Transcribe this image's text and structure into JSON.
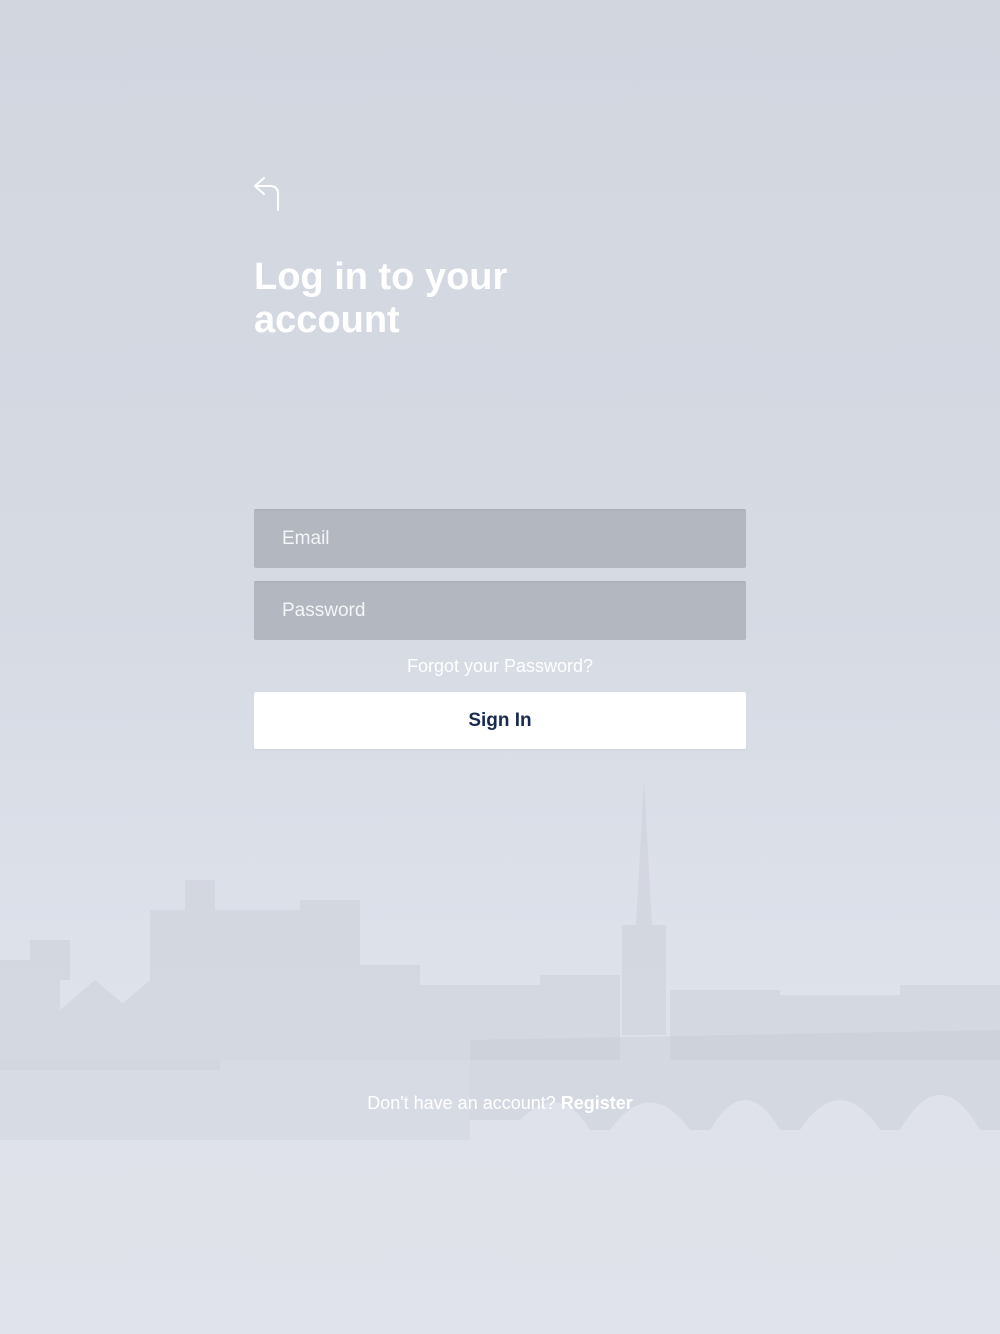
{
  "header": {
    "back_icon": "back-arrow-icon",
    "title": "Log in to your account"
  },
  "form": {
    "email_placeholder": "Email",
    "password_placeholder": "Password",
    "forgot_label": "Forgot your Password?",
    "signin_label": "Sign In"
  },
  "footer": {
    "prompt": "Don't have an account?",
    "register_label": "Register"
  },
  "colors": {
    "background": "#d2d6df",
    "field_background": "#b3b7bf",
    "button_background": "#ffffff",
    "button_text": "#182a4e",
    "text": "#ffffff"
  }
}
